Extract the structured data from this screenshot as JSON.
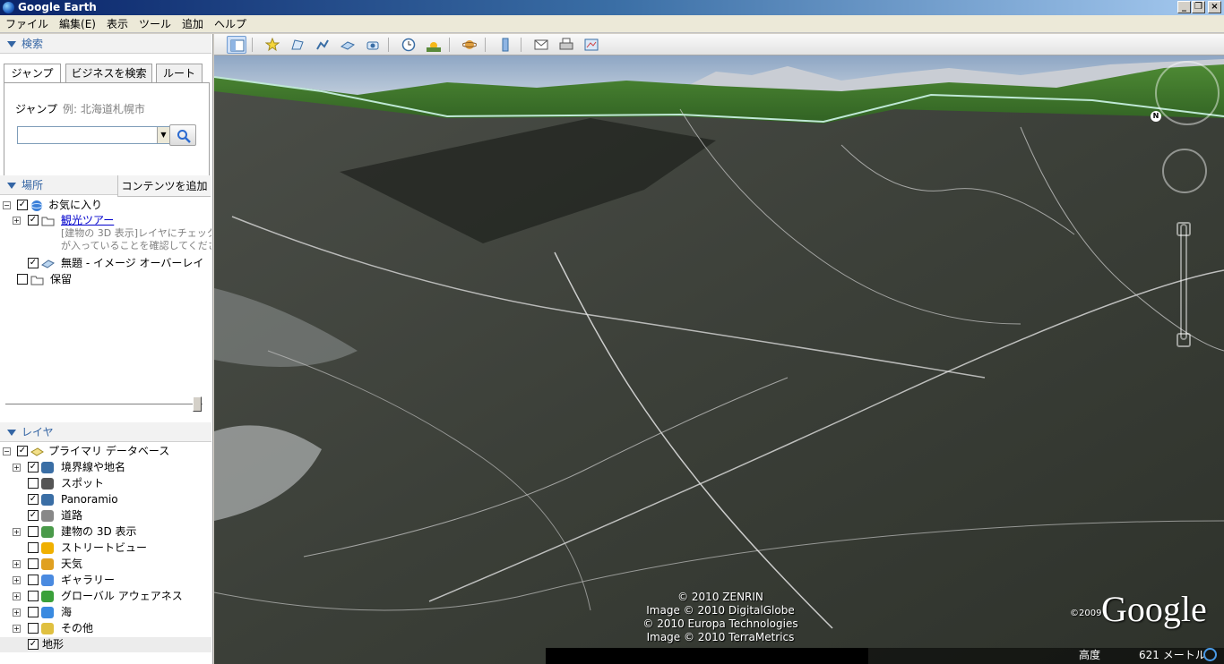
{
  "window": {
    "title": "Google Earth"
  },
  "menu": [
    "ファイル",
    "編集(E)",
    "表示",
    "ツール",
    "追加",
    "ヘルプ"
  ],
  "search": {
    "header": "検索",
    "tabs": [
      "ジャンプ",
      "ビジネスを検索",
      "ルート"
    ],
    "jump_label": "ジャンプ",
    "jump_hint": "例: 北海道札幌市",
    "input_value": ""
  },
  "places": {
    "header": "場所",
    "add_content": "コンテンツを追加",
    "favorites": "お気に入り",
    "tour": "観光ツアー",
    "tour_desc_1": "[建物の 3D 表示]レイヤにチェック",
    "tour_desc_2": "が入っていることを確認してくださ",
    "overlay": "無題 - イメージ オーバーレイ",
    "temporary": "保留"
  },
  "layers": {
    "header": "レイヤ",
    "primary": "プライマリ データベース",
    "items": [
      "境界線や地名",
      "スポット",
      "Panoramio",
      "道路",
      "建物の 3D 表示",
      "ストリートビュー",
      "天気",
      "ギャラリー",
      "グローバル アウェアネス",
      "海",
      "その他",
      "地形"
    ]
  },
  "viewer": {
    "credits": [
      "© 2010 ZENRIN",
      "Image © 2010 DigitalGlobe",
      "© 2010 Europa Technologies",
      "Image © 2010 TerraMetrics"
    ],
    "logo": "Google",
    "logo_year": "©2009",
    "altitude_label": "高度",
    "altitude_value": "621 メートル"
  }
}
